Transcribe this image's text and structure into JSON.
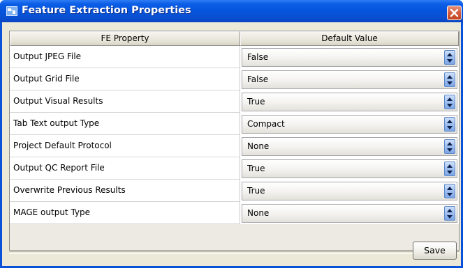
{
  "window": {
    "title": "Feature Extraction Properties",
    "icon": "app-icon",
    "close_icon": "close-icon",
    "accent_color": "#0a53d8"
  },
  "table": {
    "headers": {
      "property": "FE Property",
      "value": "Default Value"
    },
    "rows": [
      {
        "property": "Output JPEG File",
        "value": "False"
      },
      {
        "property": "Output Grid File",
        "value": "False"
      },
      {
        "property": "Output Visual Results",
        "value": "True"
      },
      {
        "property": "Tab Text output Type",
        "value": "Compact"
      },
      {
        "property": "Project Default Protocol",
        "value": "None"
      },
      {
        "property": "Output QC Report File",
        "value": "True"
      },
      {
        "property": "Overwrite Previous Results",
        "value": "True"
      },
      {
        "property": "MAGE output Type",
        "value": "None"
      }
    ]
  },
  "footer": {
    "save_label": "Save"
  }
}
